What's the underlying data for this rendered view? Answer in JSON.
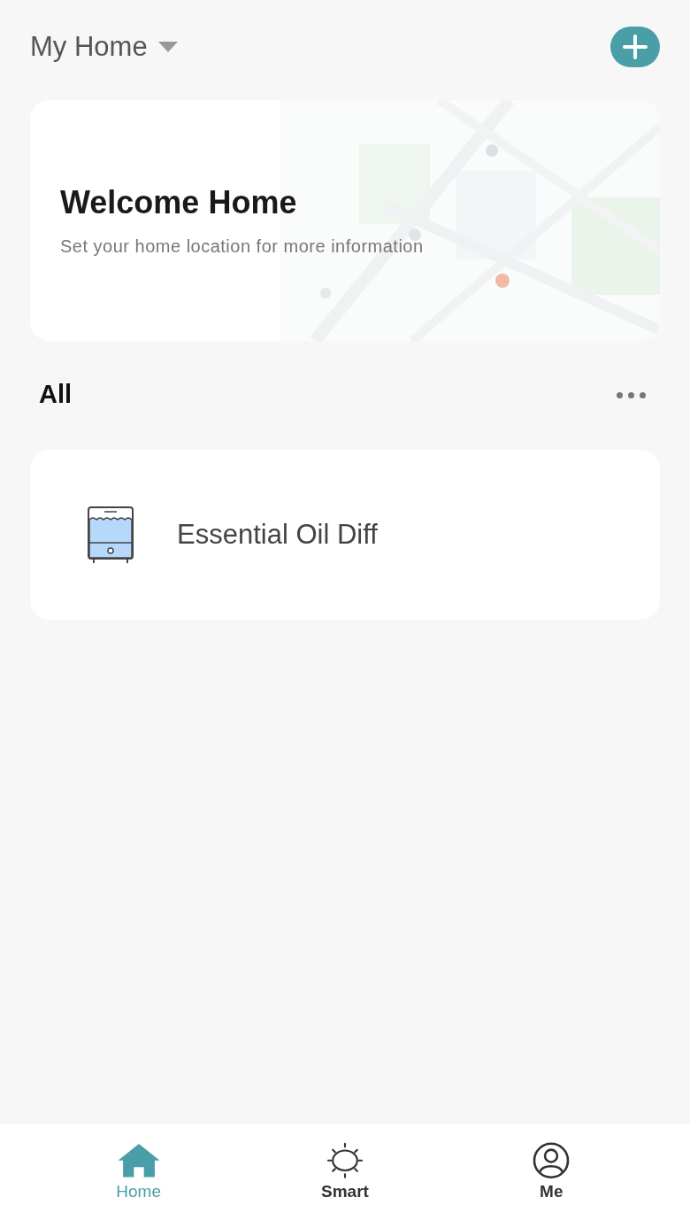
{
  "header": {
    "home_name": "My Home"
  },
  "welcome_card": {
    "title": "Welcome Home",
    "subtitle": "Set your home location for more information"
  },
  "section": {
    "title": "All"
  },
  "devices": [
    {
      "name": "Essential Oil Diff",
      "kind": "diffuser"
    }
  ],
  "tab_bar": [
    {
      "label": "Home",
      "kind": "home",
      "selected": true
    },
    {
      "label": "Smart",
      "kind": "smart",
      "selected": false
    },
    {
      "label": "Me",
      "kind": "me",
      "selected": false
    }
  ]
}
